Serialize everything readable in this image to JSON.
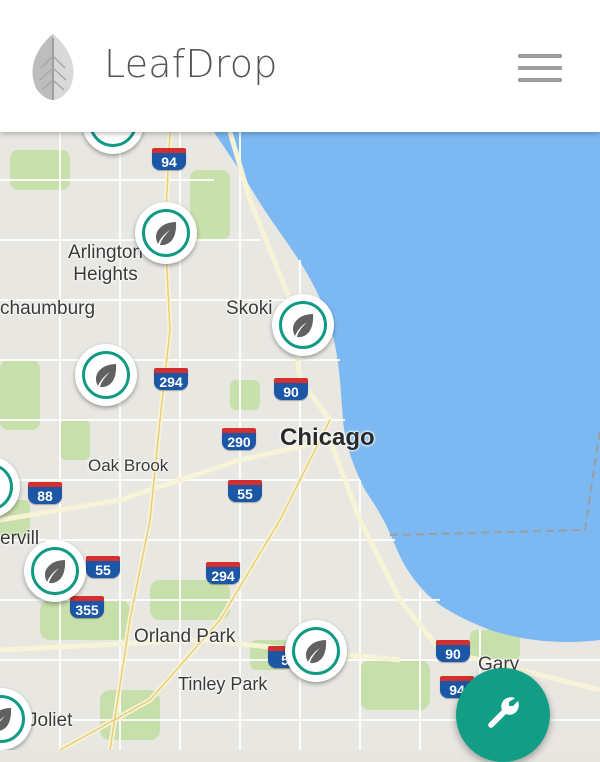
{
  "app": {
    "title": "LeafDrop"
  },
  "map": {
    "labels": {
      "arlington": "Arlington\nHeights",
      "schaumburg": "chaumburg",
      "skokie": "Skoki",
      "chicago": "Chicago",
      "oak_brook": "Oak Brook",
      "naperville": "ervill",
      "orland_park": "Orland Park",
      "tinley_park": "Tinley Park",
      "joliet": "Joliet",
      "gary": "Gary"
    },
    "shields": {
      "i94_top": "94",
      "i294_north": "294",
      "i90_north": "90",
      "i290": "290",
      "i88": "88",
      "i55_mid": "55",
      "i355": "355",
      "i55_west": "55",
      "i294_south": "294",
      "i57": "5",
      "i90_south": "90",
      "i94_south": "94"
    }
  },
  "icons": {
    "leaf": "leaf-icon",
    "menu": "hamburger-menu-icon",
    "wrench": "wrench-icon"
  },
  "colors": {
    "accent": "#119a83",
    "water": "#7cb9f3"
  }
}
